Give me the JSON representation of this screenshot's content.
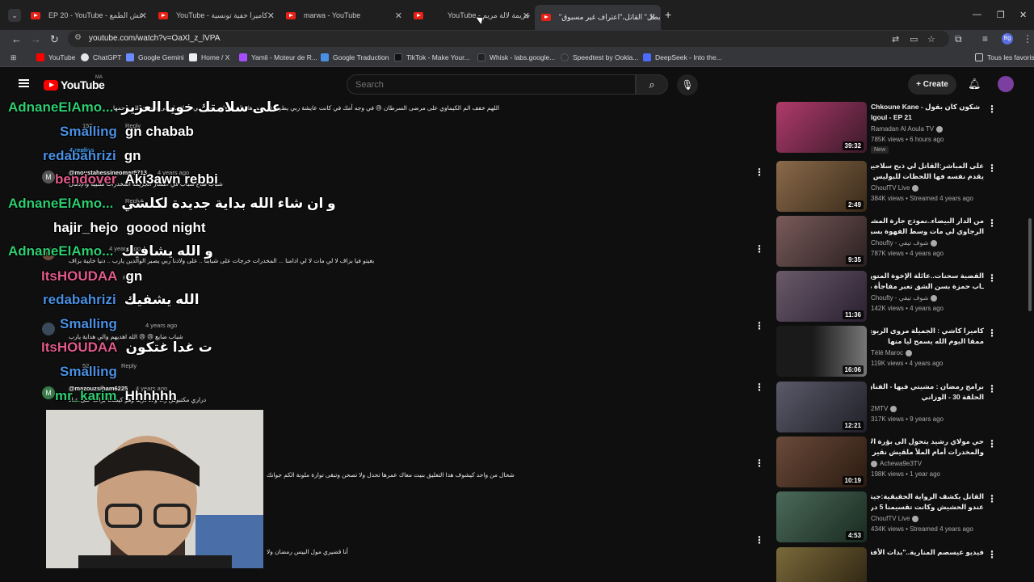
{
  "browser": {
    "tabs": [
      {
        "title": "EP 20 - YouTube - عش الطمع",
        "active": false
      },
      {
        "title": "YouTube - كاميرا خفية تونسية",
        "active": false
      },
      {
        "title": "marwa - YouTube",
        "active": false
      },
      {
        "title": "YouTube - جريمة لالة مريم",
        "active": false
      },
      {
        "title": "\"بطل\" القاتل،\"اعتراف غير مسبوق",
        "active": true
      }
    ],
    "new_tab": "+",
    "url": "youtube.com/watch?v=OaXl_z_lVPA",
    "bookmarks": [
      {
        "label": "YouTube",
        "color": "#ff0000"
      },
      {
        "label": "ChatGPT",
        "color": "#ffffff"
      },
      {
        "label": "Google Gemini",
        "color": "#6b8cff"
      },
      {
        "label": "Home / X",
        "color": "#ffffff"
      },
      {
        "label": "Yamli - Moteur de R...",
        "color": "#a64dff"
      },
      {
        "label": "Google Traduction",
        "color": "#4a90e2"
      },
      {
        "label": "TikTok - Make Your...",
        "color": "#111111"
      },
      {
        "label": "Whisk - labs.google...",
        "color": "#222222"
      },
      {
        "label": "Speedtest by Ookla...",
        "color": "#333333"
      },
      {
        "label": "DeepSeek - Into the...",
        "color": "#4d6bfe"
      }
    ],
    "all_bookmarks": "Tous les favoris",
    "profile_initials": "Bg"
  },
  "youtube": {
    "logo_text": "YouTube",
    "country": "MA",
    "search_placeholder": "Search",
    "create_label": "Create"
  },
  "comments": {
    "items": [
      {
        "handle": "",
        "text": "اللهم خفف الم الكيماوي على مرضى السرطان 😢 في وجه أمك في كانت عايشة ربي يطول في عمرها والى راها مريضة ربي يشافيها والى متوفية الله يرحمها",
        "meta": "",
        "likes": "150",
        "reply": "Reply"
      },
      {
        "handle": "",
        "text": "",
        "meta": "",
        "likes": "",
        "reply": "",
        "replies": "4 replies"
      },
      {
        "handle": "@moustahessineomar5713",
        "text": "شباب ضاع سباب في انتشار الجريمة المخدرات سلبية والإدمان",
        "meta": "4 years ago",
        "likes": "",
        "reply": "Reply"
      },
      {
        "handle": "",
        "text": "بغيتو فيا بزاف لا لي مات لا لي ادامنا ... المخدرات خرجات على شبابنا .. على ولادنا ربي يصبر الوالدين يارب .. دنيا خايبة بزاف",
        "meta": "4 years ago",
        "likes": "",
        "reply": "Reply"
      },
      {
        "handle": "",
        "text": "شباب ضايع 😢 😢 الله اهديهم والي هداية يارب",
        "meta": "4 years ago",
        "likes": "52",
        "reply": "Reply"
      },
      {
        "handle": "@mazouzsiham6225",
        "text": "دراري مكتبوش راه ولاد دربنا وهو كيضحا بزاف على عباد",
        "meta": "4 years ago",
        "likes": "",
        "reply": ""
      },
      {
        "handle": "",
        "text": "شحال من واحد كيشوف هدا التعليق بنيت معاك عمرها تحدل ولا تصحن وتبقى توارة ملونة الكم جوانك",
        "meta": "",
        "likes": "",
        "reply": ""
      },
      {
        "handle": "",
        "text": "أنا قضيري مول البيس رمضان ولا",
        "meta": "",
        "likes": "",
        "reply": ""
      }
    ],
    "avatar_letter": "M"
  },
  "live_chat": [
    {
      "name": "AdnaneElAmo...",
      "message": "على سلامتك خويا العزيز",
      "color": "#2ecc71"
    },
    {
      "name": "Smalling",
      "message": "gn chabab",
      "color": "#4a90e2"
    },
    {
      "name": "redabahrizi",
      "message": "gn",
      "color": "#4a90e2"
    },
    {
      "name": "bendover",
      "message": "Aki3awn rebbi",
      "color": "#e05a8a"
    },
    {
      "name": "AdnaneElAmo...",
      "message": "و ان شاء الله بداية جديدة لكلشي",
      "color": "#2ecc71"
    },
    {
      "name": "hajir_hejo",
      "message": "goood night",
      "color": "#ffffff"
    },
    {
      "name": "AdnaneElAmo...",
      "message": "و الله يشافيك",
      "color": "#2ecc71"
    },
    {
      "name": "ItsHOUDAA",
      "message": "gn",
      "color": "#e05a8a"
    },
    {
      "name": "redabahrizi",
      "message": "الله يشفيك",
      "color": "#4a90e2"
    },
    {
      "name": "Smalling",
      "message": "",
      "color": "#4a90e2"
    },
    {
      "name": "ItsHOUDAA",
      "message": "ت غدا غتكون",
      "color": "#e05a8a"
    },
    {
      "name": "Smalling",
      "message": "",
      "color": "#4a90e2"
    },
    {
      "name": "mr_karim",
      "message": "Hhhhhh",
      "color": "#2ecc71"
    }
  ],
  "sidebar": {
    "items": [
      {
        "title_line1": "Chkoune Kane - شكون كان بقول",
        "title_line2": "lgoul - EP 21",
        "channel": "Ramadan Al Aoula TV",
        "meta": "785K views • 6 hours ago",
        "badge": "New",
        "duration": "39:32",
        "thumb_color": "#b03a6a",
        "rtl": false
      },
      {
        "title_line1": "على المباشر:القاتل لي ذبح سلاحيو «قتلة مريم",
        "title_line2": "يقدم نفسه فها اللحظات للبوليس بحضور",
        "channel": "ChoufTV Live",
        "meta": "384K views • Streamed 4 years ago",
        "badge": "",
        "duration": "2:49",
        "thumb_color": "#8a6a4a",
        "rtl": true
      },
      {
        "title_line1": "من الدار البيضاء..نموذج جارة المشجع",
        "title_line2": "الرجاوي لي مات وسط الفهوة بسبب هدف",
        "channel": "Choufty - شوف تيفي",
        "meta": "787K views • 4 years ago",
        "badge": "",
        "duration": "9:35",
        "thumb_color": "#7a5a5a",
        "rtl": true
      },
      {
        "title_line1": "القضية سحنات..عائلة الإخوة المتورطين فقتل",
        "title_line2": "ـاب حمزة بسن الشق تعبر مفاجأة من الجيار",
        "channel": "Choufty - شوف تيفي",
        "meta": "142K views • 4 years ago",
        "badge": "",
        "duration": "11:36",
        "thumb_color": "#6a5a6a",
        "rtl": true
      },
      {
        "title_line1": "كاميرا كاشي : الجميلة مروى الريوي بكات",
        "title_line2": "ممقا اليوم الله يسمح ليا منها",
        "channel": "Télé Maroc",
        "meta": "119K views • 4 years ago",
        "badge": "",
        "duration": "16:06",
        "thumb_color": "#3a3a3a",
        "rtl": true
      },
      {
        "title_line1": "برامج رمضان : مشيتي فيها - الفنان مهدي",
        "title_line2": "الحلقة 30 - الوزاني",
        "channel": "2MTV",
        "meta": "317K views • 9 years ago",
        "badge": "",
        "duration": "12:21",
        "thumb_color": "#5a5a6a",
        "rtl": true
      },
      {
        "title_line1": "حي مولاي رشيد يتحول الى بؤرة الإجرام",
        "title_line2": "والمخدرات أمام الملأ ملقيش نقير تصبح",
        "channel": "Achewa9e3TV",
        "meta": "198K views • 1 year ago",
        "badge": "",
        "duration": "10:19",
        "thumb_color": "#6a4a3a",
        "rtl": true
      },
      {
        "title_line1": "القاتل يكشف الرواية الحقيقية:جيتا نصاور من",
        "title_line2": "عندو الحشيش وكانت تقسيمنا 5 دراهم وزمات",
        "channel": "ChoufTV Live",
        "meta": "434K views • Streamed 4 years ago",
        "badge": "",
        "duration": "4:53",
        "thumb_color": "#4a6a5a",
        "rtl": true
      },
      {
        "title_line1": "فيديو عيسصم المنارية..\"بدات الأفة\" كيحسو",
        "title_line2": "",
        "channel": "",
        "meta": "",
        "badge": "",
        "duration": "",
        "thumb_color": "#7a6a3a",
        "rtl": true
      }
    ]
  }
}
